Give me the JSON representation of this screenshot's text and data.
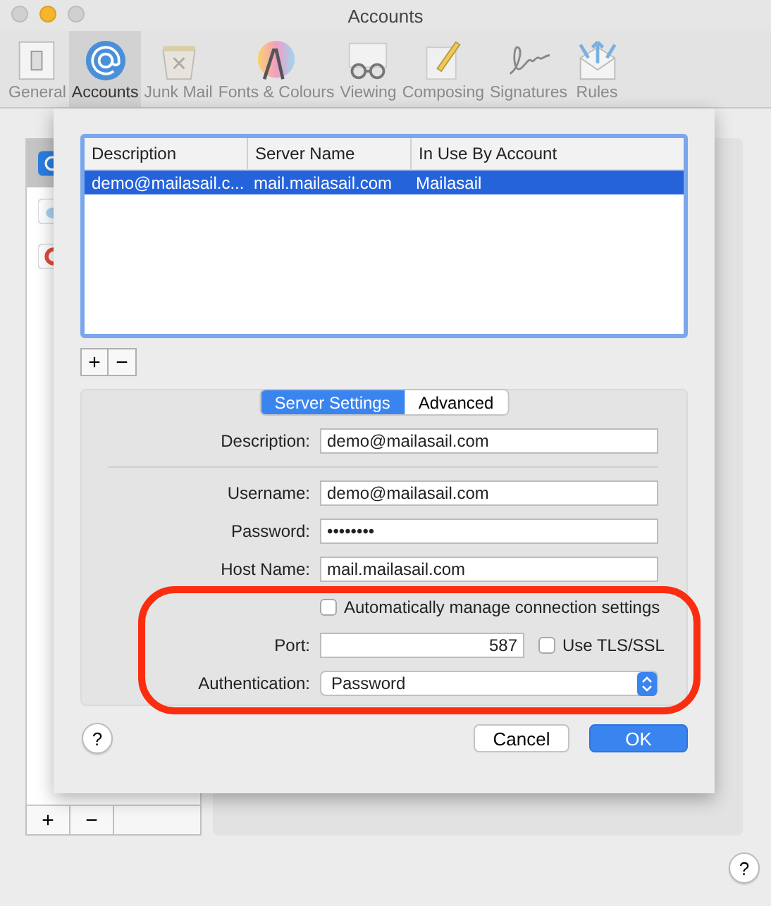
{
  "window": {
    "title": "Accounts"
  },
  "toolbar": [
    {
      "label": "General",
      "selected": false
    },
    {
      "label": "Accounts",
      "selected": true
    },
    {
      "label": "Junk Mail",
      "selected": false
    },
    {
      "label": "Fonts & Colours",
      "selected": false
    },
    {
      "label": "Viewing",
      "selected": false
    },
    {
      "label": "Composing",
      "selected": false
    },
    {
      "label": "Signatures",
      "selected": false
    },
    {
      "label": "Rules",
      "selected": false
    }
  ],
  "account_list": {
    "add": "+",
    "remove": "−"
  },
  "sheet": {
    "table": {
      "columns": [
        "Description",
        "Server Name",
        "In Use By Account"
      ],
      "rows": [
        {
          "cells": [
            "demo@mailasail.c...",
            "mail.mailasail.com",
            "Mailasail"
          ],
          "selected": true
        }
      ]
    },
    "add": "+",
    "remove": "−",
    "tabs": [
      {
        "label": "Server Settings",
        "selected": true
      },
      {
        "label": "Advanced",
        "selected": false
      }
    ],
    "fields": [
      {
        "kind": "text",
        "label": "Description:",
        "value": "demo@mailasail.com"
      },
      {
        "kind": "separator"
      },
      {
        "kind": "text",
        "label": "Username:",
        "value": "demo@mailasail.com"
      },
      {
        "kind": "text",
        "label": "Password:",
        "value": "••••••••"
      },
      {
        "kind": "text",
        "label": "Host Name:",
        "value": "mail.mailasail.com"
      },
      {
        "kind": "checkbox",
        "label": "Automatically manage connection settings",
        "checked": false
      },
      {
        "kind": "port",
        "label": "Port:",
        "value": "587",
        "option": {
          "label": "Use TLS/SSL",
          "checked": false
        }
      },
      {
        "kind": "popup",
        "label": "Authentication:",
        "value": "Password"
      }
    ],
    "help": "?",
    "cancel": "Cancel",
    "ok": "OK"
  },
  "help": "?"
}
